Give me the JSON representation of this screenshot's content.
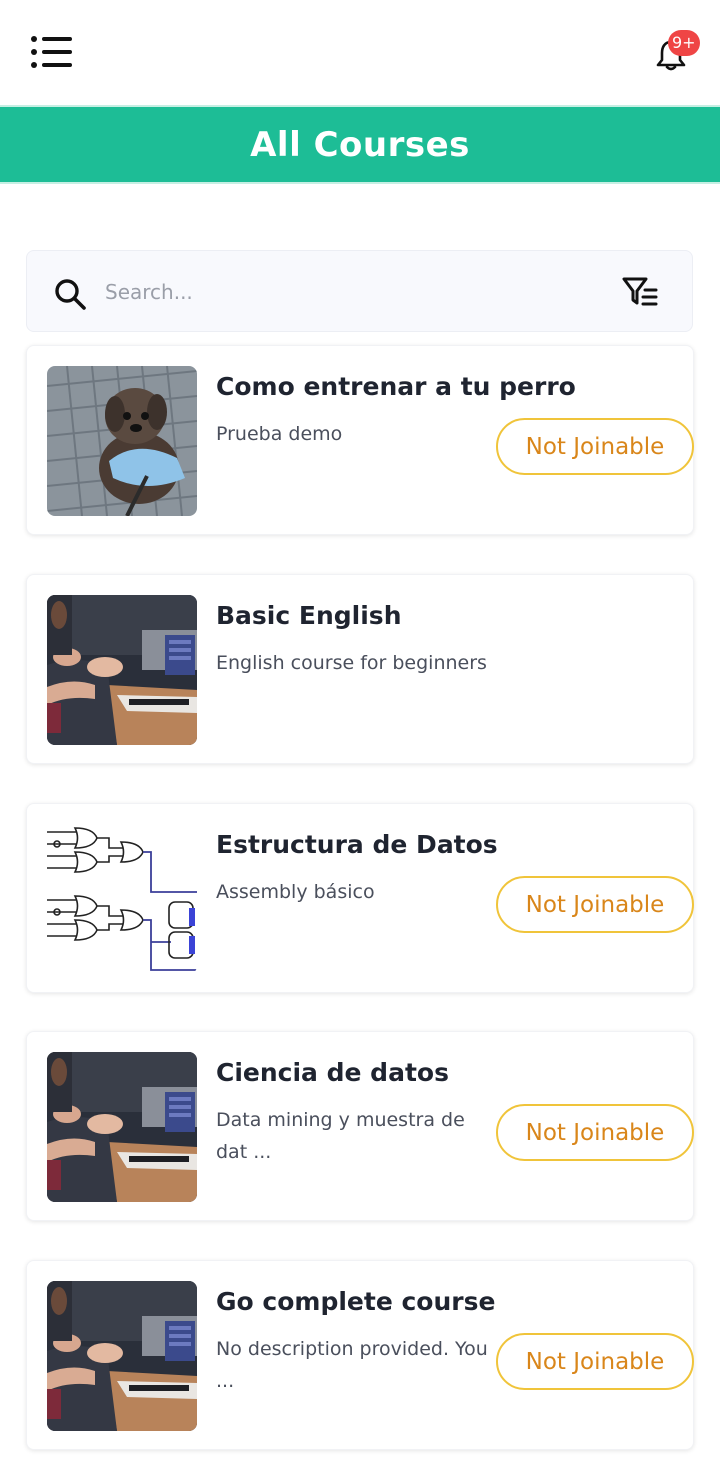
{
  "header": {
    "menu_icon": "menu-list-icon",
    "notifications": {
      "icon": "bell-icon",
      "badge": "9+",
      "badge_color": "#ef4545"
    }
  },
  "page": {
    "title": "All Courses",
    "accent_color": "#1dbd96"
  },
  "search": {
    "placeholder": "Search...",
    "value": "",
    "icon": "search-icon",
    "filter_icon": "filter-list-icon"
  },
  "courses": [
    {
      "title": "Como entrenar a tu perro",
      "description": "Prueba demo",
      "thumbnail": "dog-photo",
      "button": "Not Joinable"
    },
    {
      "title": "Basic English",
      "description": "English course for beginners",
      "thumbnail": "meeting-hands-photo",
      "button": ""
    },
    {
      "title": "Estructura de Datos",
      "description": "Assembly básico",
      "thumbnail": "logic-circuit-diagram",
      "button": "Not Joinable"
    },
    {
      "title": "Ciencia de datos",
      "description": "Data mining y muestra de dat ...",
      "thumbnail": "meeting-hands-photo",
      "button": "Not Joinable"
    },
    {
      "title": "Go complete course",
      "description": "No description provided. You ...",
      "thumbnail": "meeting-hands-photo",
      "button": "Not Joinable"
    }
  ],
  "colors": {
    "button_border": "#f0c43a",
    "button_text": "#d9861a"
  }
}
